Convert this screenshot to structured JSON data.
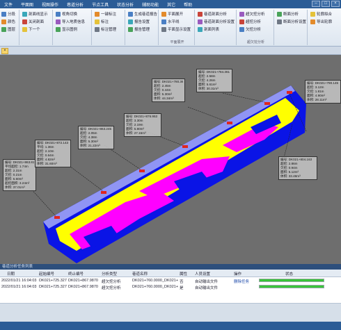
{
  "menu": [
    "文件",
    "平面图",
    "视图操作",
    "巷道分析",
    "节点工具",
    "状态分析",
    "辅助功能",
    "其它",
    "帮助"
  ],
  "ribbon": {
    "group1_items": [
      "分段",
      "颜色",
      "图层"
    ],
    "group2_items": [
      "剖面线显示",
      "关闭剖面",
      "下一个"
    ],
    "group3_items": [
      "视角切换",
      "导入地质信息",
      "显示图例"
    ],
    "group4_items": [
      "一键标注",
      "标注",
      "标注管理"
    ],
    "group5_items": [
      "生成巷道报告",
      "报告设置",
      "报告管理"
    ],
    "group6_items": [
      "平面展开",
      "水平线",
      "平面显示设置"
    ],
    "group6_label": "平面展开",
    "group7_items": [
      "巷道剖面分析",
      "巷道剖面分析设置",
      "剖面列表"
    ],
    "group8_items": [
      "超欠挖分析",
      "超挖分析",
      "欠挖分析"
    ],
    "group8_label": "超欠挖分析",
    "group9_items": [
      "断面分析",
      "断面分析设置"
    ],
    "group10_items": [
      "轮廓拟合",
      "导出轮廓"
    ]
  },
  "colors": {
    "overbreak": "#ff00ff",
    "underbreak": "#0000ff",
    "fit": "#ffff00",
    "viewport_bg": "#6e6e6e"
  },
  "annotations": [
    [
      "编号: DK021+863.816",
      "平均超挖: 1.74m",
      "超挖: 2.31m",
      "欠挖: 0.21m",
      "面积: 5.60m²",
      "超挖面积: 3.24m²",
      "体积: 37.01m³"
    ],
    [
      "编号: DK021+872.143",
      "平均: 1.36m",
      "超挖: 2.10m",
      "欠挖: 0.64m",
      "面积: 4.82m²",
      "体积: 31.60m³"
    ],
    [
      "编号: DK021+863.245",
      "超挖: 2.05m",
      "欠挖: 4.38m",
      "面积: 5.30m²",
      "体积: 21.22m³"
    ],
    [
      "编号: DK021+876.953",
      "超挖: 3.30m",
      "欠挖: 2.19m",
      "面积: 5.80m²",
      "体积: 27.15m³"
    ],
    [
      "编号: DK021+780.360",
      "超挖: 2.45m",
      "欠挖: 0.44m",
      "面积: 5.30m²",
      "体积: 44.34m³"
    ],
    [
      "编号: DK021+784.361",
      "超挖: 2.58m",
      "欠挖: 4.26m",
      "面积: 5.61m²",
      "体积: 30.31m³"
    ],
    [
      "编号: DK021+790.145",
      "超挖: 3.12m",
      "欠挖: 1.81m",
      "面积: 4.90m²",
      "体积: 28.11m³"
    ],
    [
      "编号: DK021+804.163",
      "超挖: 2.86m",
      "欠挖: 0.94m",
      "面积: 5.12m²",
      "体积: 33.48m³"
    ]
  ],
  "panel": {
    "title": "巷道分析任务列表"
  },
  "table": {
    "headers": [
      "日期",
      "起始编号",
      "终止编号",
      "分析类型",
      "巷道名称",
      "属性",
      "人员设置",
      "操作",
      "状态"
    ],
    "rows": [
      {
        "cells": [
          "2022/01/21 16:04:03",
          "DK021+725.3270",
          "DK021+867.9870",
          "超欠挖分析",
          "DK021+760.0000_DK021+900",
          "否",
          "自动输出文件",
          "删除任务"
        ],
        "progress": 1.0
      },
      {
        "cells": [
          "2022/01/21 16:04:03",
          "DK021+725.3270",
          "DK021+867.9870",
          "超欠挖分析",
          "DK021+760.0000_DK021+900",
          "是",
          "自动输出文件",
          ""
        ],
        "progress": 1.0
      }
    ]
  }
}
